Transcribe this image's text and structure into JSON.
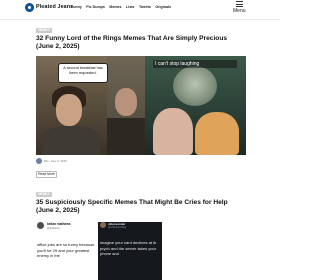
{
  "header": {
    "brand": "Pleated Jeans",
    "nav": [
      "Funny",
      "Pic Dumps",
      "Memes",
      "Lists",
      "Tweets",
      "Originals"
    ],
    "menu_label": "Menu"
  },
  "post1": {
    "badge": "MEMES",
    "title": "32 Funny Lord of the Rings Memes That Are Simply Precious (June 2, 2025)",
    "bubble_text": "A second breakfast has been requested.",
    "caption": "I can't stop laughing",
    "author": "Mia",
    "date": "June 2, 2025",
    "read_more": "Read More"
  },
  "post2": {
    "badge": "MEMES",
    "title": "35 Suspiciously Specific Memes That Might Be Cries for Help (June 2, 2025)",
    "tweet_left": {
      "name": "kellan mathews",
      "handle": "@kellanM",
      "text": "office jobs are so funny because you'll be 29 and your greatest enemy in the"
    },
    "tweet_right": {
      "name": "vibesvender",
      "handle": "@Vibesvending",
      "text": "imagine your card declines at tk prych and the server takes your phone and"
    }
  },
  "colors": {
    "badge": "#c9c9c9",
    "logo": "#0d5aa7",
    "text": "#111111",
    "muted": "#777777"
  }
}
